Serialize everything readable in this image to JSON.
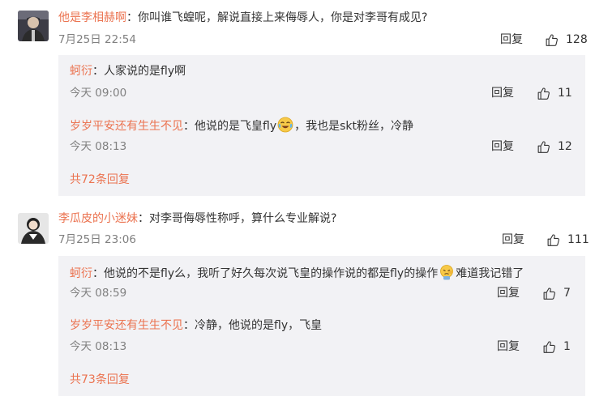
{
  "comments": [
    {
      "username": "他是李相赫啊",
      "text": "你叫谁飞蝗呢，解说直接上来侮辱人，你是对李哥有成见?",
      "time": "7月25日 22:54",
      "reply_label": "回复",
      "likes": "128",
      "replies": [
        {
          "username": "蚵衍",
          "text": "人家说的是fly啊",
          "time": "今天 09:00",
          "reply_label": "回复",
          "likes": "11"
        },
        {
          "username": "岁岁平安还有生生不见",
          "text_before": "他说的是飞皇fly",
          "emoji": "crying-laughing-emoji",
          "text_after": "，我也是skt粉丝，冷静",
          "time": "今天 08:13",
          "reply_label": "回复",
          "likes": "12"
        }
      ],
      "more_label": "共72条回复"
    },
    {
      "username": "李瓜皮的小迷妹",
      "text": "对李哥侮辱性称呼，算什么专业解说?",
      "time": "7月25日 23:06",
      "reply_label": "回复",
      "likes": "111",
      "replies": [
        {
          "username": "蚵衍",
          "text_before": "他说的不是fly么，我听了好久每次说飞皇的操作说的都是fly的操作",
          "emoji": "facepalm-emoji",
          "text_after": "难道我记错了",
          "time": "今天 08:59",
          "reply_label": "回复",
          "likes": "7"
        },
        {
          "username": "岁岁平安还有生生不见",
          "text": "冷静，他说的是fly，飞皇",
          "time": "今天 08:13",
          "reply_label": "回复",
          "likes": "1"
        }
      ],
      "more_label": "共73条回复"
    }
  ]
}
